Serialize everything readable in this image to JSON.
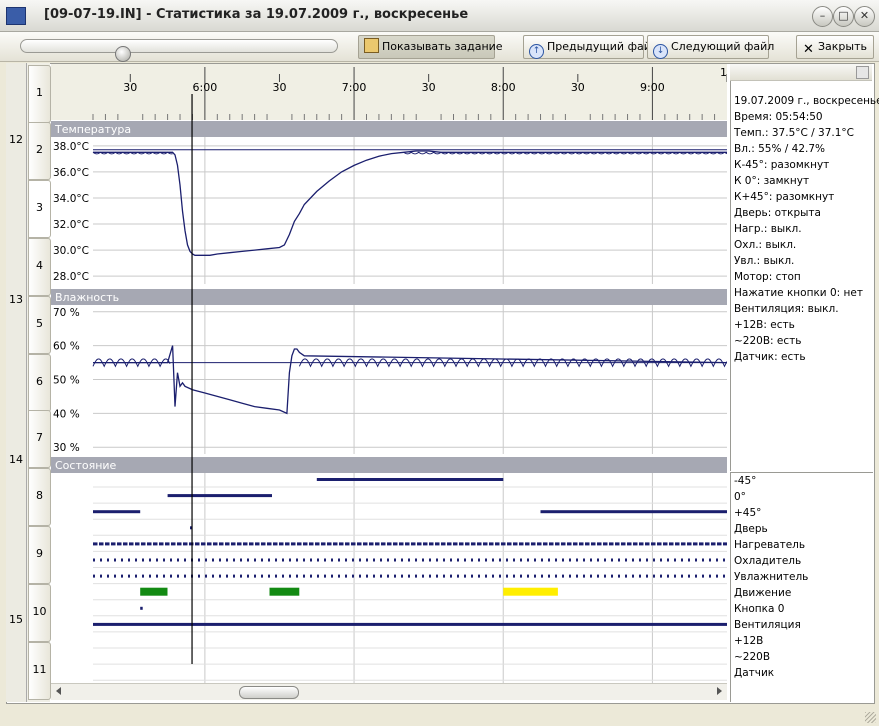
{
  "window": {
    "title": "[09-07-19.IN] - Статистика за 19.07.2009 г., воскресенье"
  },
  "toolbar": {
    "show_task_label": "Показывать задание",
    "prev_file_label": "Предыдущий файл",
    "next_file_label": "Следующий файл",
    "close_label": "Закрыть",
    "slider_position": 0.32
  },
  "sidebar": {
    "hour_labels": [
      "12",
      "13",
      "14",
      "15"
    ]
  },
  "rows": {
    "labels": [
      "1",
      "2",
      "3",
      "4",
      "5",
      "6",
      "7",
      "8",
      "9",
      "10",
      "11"
    ],
    "selected": "3"
  },
  "timeline": {
    "ticks": [
      "30",
      "6:00",
      "30",
      "7:00",
      "30",
      "8:00",
      "30",
      "9:00",
      "30",
      "1"
    ]
  },
  "cursor_time": "05:54:50",
  "chart_data": [
    {
      "type": "line",
      "title": "Температура",
      "x_unit": "minutes_of_day",
      "yticks": [
        "38.0°C",
        "36.0°C",
        "34.0°C",
        "32.0°C",
        "30.0°C",
        "28.0°C"
      ],
      "ylim": [
        27.4,
        38.6
      ],
      "setpoint": 37.7,
      "series": [
        {
          "x": [
            315,
            347,
            348,
            349,
            350,
            351,
            352,
            353,
            354,
            355,
            356,
            358,
            360,
            362,
            365,
            370,
            375,
            380,
            385,
            390,
            392,
            394,
            396,
            398,
            400,
            405,
            410,
            415,
            420,
            425,
            430,
            435,
            440,
            445,
            450,
            455,
            460,
            480,
            500,
            520,
            540,
            560,
            570
          ],
          "y": [
            37.5,
            37.5,
            37.3,
            36.5,
            35.0,
            33.0,
            31.5,
            30.4,
            29.9,
            29.7,
            29.6,
            29.6,
            29.6,
            29.6,
            29.7,
            29.8,
            29.9,
            30.0,
            30.1,
            30.2,
            30.4,
            31.2,
            32.2,
            32.8,
            33.5,
            34.5,
            35.3,
            36.0,
            36.5,
            36.9,
            37.2,
            37.4,
            37.5,
            37.6,
            37.6,
            37.5,
            37.5,
            37.5,
            37.5,
            37.5,
            37.5,
            37.5,
            37.5
          ]
        }
      ]
    },
    {
      "type": "line",
      "title": "Влажность",
      "x_unit": "minutes_of_day",
      "yticks": [
        "70 %",
        "60 %",
        "50 %",
        "40 %",
        "30 %"
      ],
      "ylim": [
        28,
        72
      ],
      "setpoint": 55,
      "series": [
        {
          "x": [
            315,
            345,
            347,
            348,
            349,
            350,
            351,
            352,
            355,
            360,
            365,
            370,
            375,
            380,
            385,
            390,
            393,
            394,
            395,
            396,
            397,
            398,
            400,
            570
          ],
          "y": [
            55,
            55,
            60,
            42,
            52,
            48,
            49,
            48,
            47,
            46,
            45,
            44,
            43,
            42,
            41.5,
            41,
            40,
            52,
            57,
            59,
            59,
            58,
            57,
            55
          ]
        }
      ]
    },
    {
      "type": "table",
      "title": "Состояние",
      "x_unit": "minutes_of_day",
      "x_range": [
        315,
        570
      ],
      "channels": [
        {
          "name": "-45°",
          "segments": [
            [
              405,
              480
            ]
          ]
        },
        {
          "name": "0°",
          "segments": [
            [
              345,
              387
            ]
          ]
        },
        {
          "name": "+45°",
          "segments": [
            [
              315,
              334
            ],
            [
              495,
              570
            ]
          ]
        },
        {
          "name": "Дверь",
          "segments": [
            [
              354,
              355
            ]
          ]
        },
        {
          "name": "Нагреватель",
          "segments": [
            [
              315,
              570
            ]
          ]
        },
        {
          "name": "Охладитель",
          "segments": [
            [
              315,
              570
            ]
          ]
        },
        {
          "name": "Увлажнитель",
          "segments": [
            [
              315,
              570
            ]
          ]
        },
        {
          "name": "Движение",
          "segments": [
            [
              334,
              345
            ],
            [
              386,
              398
            ],
            [
              480,
              502
            ]
          ]
        },
        {
          "name": "Кнопка 0",
          "segments": [
            [
              334,
              335
            ]
          ]
        },
        {
          "name": "Вентиляция",
          "segments": [
            [
              315,
              570
            ]
          ]
        },
        {
          "name": "+12В",
          "segments": []
        },
        {
          "name": "~220В",
          "segments": []
        },
        {
          "name": "Датчик",
          "segments": []
        }
      ],
      "colors": {
        "default": "#1b1f6e",
        "Движение_1": "#138a13",
        "Движение_2": "#138a13",
        "Движение_3": "#ffee00"
      }
    }
  ],
  "sections": {
    "temp": "Температура",
    "hum": "Влажность",
    "state": "Состояние"
  },
  "info": {
    "lines": [
      "19.07.2009 г., воскресенье",
      "Время: 05:54:50",
      "Темп.: 37.5°C / 37.1°C",
      "Вл.:  55% / 42.7%",
      "К-45°: разомкнут",
      "К 0°: замкнут",
      "К+45°: разомкнут",
      "Дверь: открыта",
      "Нагр.: выкл.",
      "Охл.: выкл.",
      "Увл.: выкл.",
      "Мотор: стоп",
      "Нажатие кнопки 0: нет",
      "Вентиляция: выкл.",
      "+12В: есть",
      "~220В: есть",
      "Датчик: есть"
    ]
  },
  "legend": {
    "items": [
      "-45°",
      "0°",
      "+45°",
      "Дверь",
      "Нагреватель",
      "Охладитель",
      "Увлажнитель",
      "Движение",
      "Кнопка 0",
      "Вентиляция",
      "+12В",
      "~220В",
      "Датчик"
    ]
  },
  "colors": {
    "series": "#1b1f6e",
    "section_header": "#a6a8b3",
    "grid": "#c9c9c9",
    "axis_bg": "#f0efe4"
  }
}
